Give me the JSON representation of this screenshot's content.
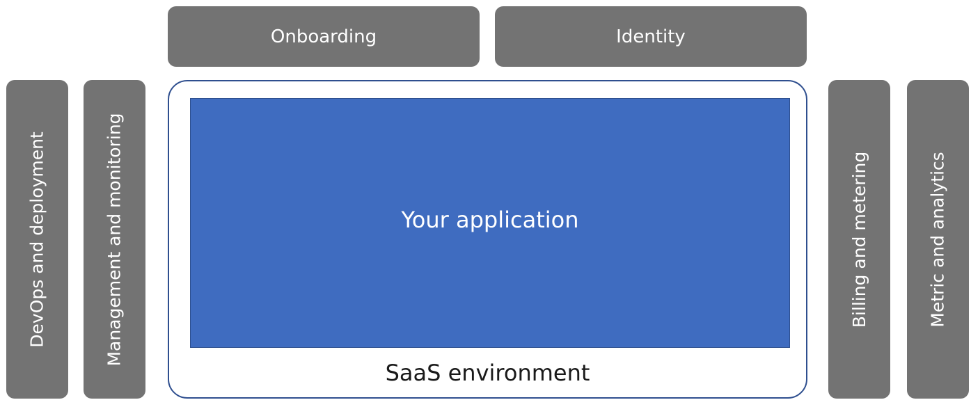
{
  "top_boxes": {
    "onboarding": "Onboarding",
    "identity": "Identity"
  },
  "left_boxes": {
    "devops": "DevOps and deployment",
    "management": "Management and monitoring"
  },
  "right_boxes": {
    "billing": "Billing and metering",
    "metric": "Metric and analytics"
  },
  "center": {
    "application": "Your application",
    "environment": "SaaS environment"
  },
  "colors": {
    "service_box": "#737373",
    "application_box": "#3f6cc0",
    "environment_border": "#2f4f8f"
  }
}
